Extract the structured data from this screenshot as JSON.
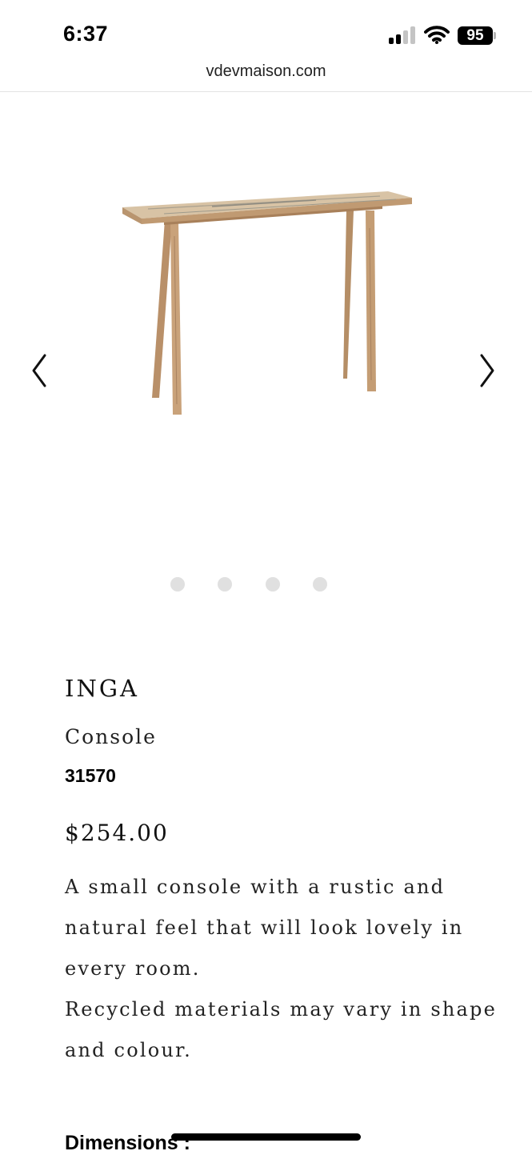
{
  "status_bar": {
    "time": "6:37",
    "battery_level": "95"
  },
  "browser": {
    "url": "vdevmaison.com"
  },
  "gallery": {
    "prev_icon": "chevron-left-icon",
    "next_icon": "chevron-right-icon",
    "slide_count": 4,
    "active_slide": 1
  },
  "product": {
    "name": "INGA",
    "category": "Console",
    "sku": "31570",
    "price": "$254.00",
    "description": [
      "A small console with a rustic and natural feel that will look lovely in every room.",
      "Recycled materials may vary in shape and colour."
    ],
    "dimensions_heading": "Dimensions :"
  },
  "colors": {
    "wood": "#c9a27a",
    "dot_inactive": "#e0e0e0",
    "text": "#111111"
  }
}
